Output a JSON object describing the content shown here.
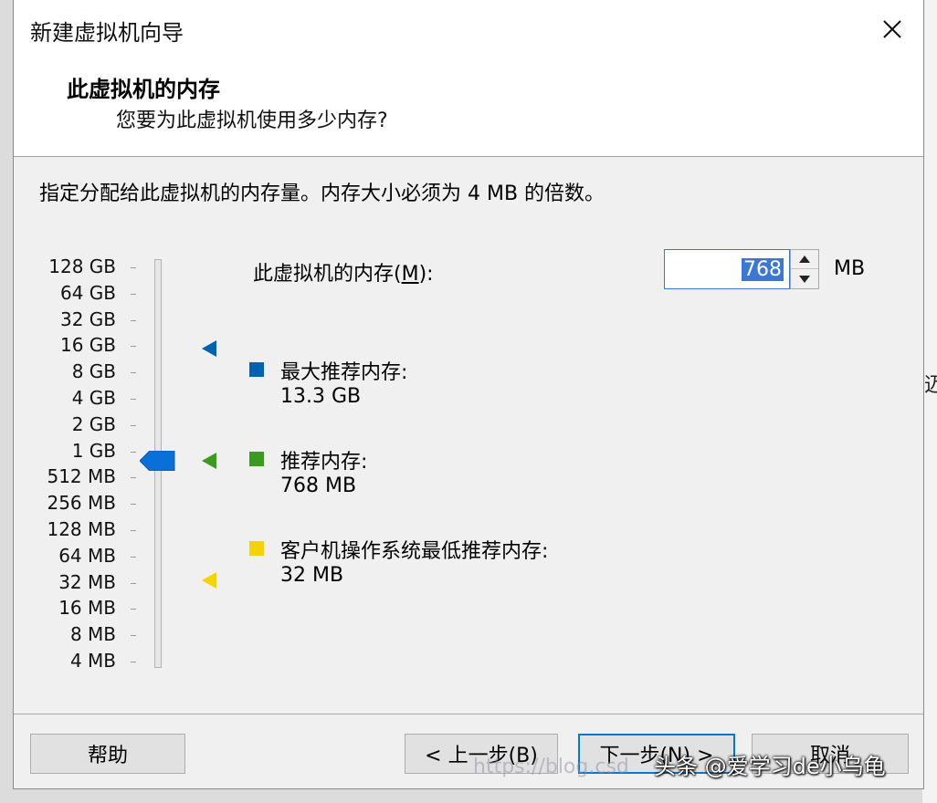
{
  "window": {
    "title": "新建虚拟机向导"
  },
  "header": {
    "title": "此虚拟机的内存",
    "subtitle": "您要为此虚拟机使用多少内存?"
  },
  "instruction": "指定分配给此虚拟机的内存量。内存大小必须为 4 MB 的倍数。",
  "scale_labels": [
    "128 GB",
    "64 GB",
    "32 GB",
    "16 GB",
    "8 GB",
    "4 GB",
    "2 GB",
    "1 GB",
    "512 MB",
    "256 MB",
    "128 MB",
    "64 MB",
    "32 MB",
    "16 MB",
    "8 MB",
    "4 MB"
  ],
  "memory": {
    "label_prefix": "此虚拟机的内存(",
    "label_mnemonic": "M",
    "label_suffix": "):",
    "value": "768",
    "unit": "MB"
  },
  "legend": {
    "max": {
      "label": "最大推荐内存:",
      "value": "13.3 GB",
      "color": "#0063b1"
    },
    "recommended": {
      "label": "推荐内存:",
      "value": "768 MB",
      "color": "#3c9a1e"
    },
    "min": {
      "label": "客户机操作系统最低推荐内存:",
      "value": "32 MB",
      "color": "#f5d300"
    }
  },
  "buttons": {
    "help": "帮助",
    "back": "< 上一步(B)",
    "next": "下一步(N) >",
    "cancel": "取消"
  },
  "watermark": {
    "text": "头条 @爱学习de小乌龟",
    "url": "https://blog.csd"
  },
  "colors": {
    "slider_thumb": "#0a6fd6",
    "focus_border": "#0078d7"
  }
}
